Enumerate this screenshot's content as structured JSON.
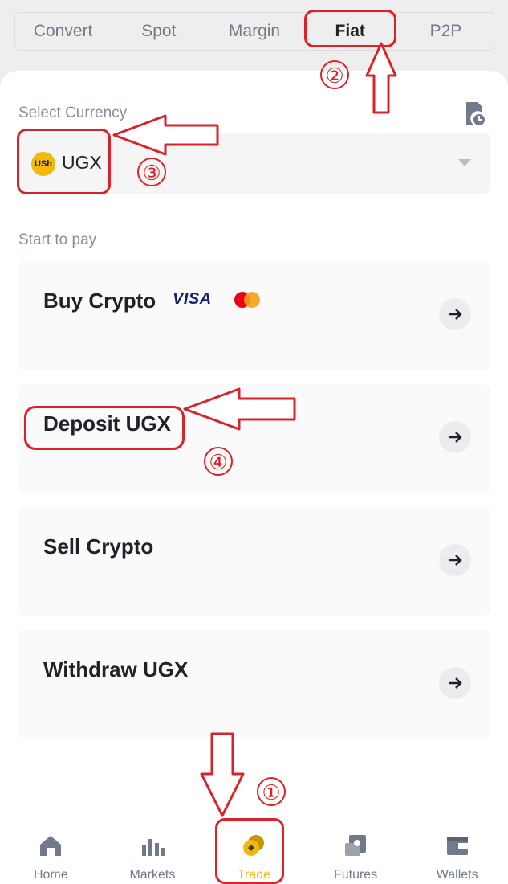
{
  "tabs": [
    "Convert",
    "Spot",
    "Margin",
    "Fiat",
    "P2P"
  ],
  "active_tab": "Fiat",
  "select_currency_label": "Select Currency",
  "currency": {
    "badge": "USh",
    "code": "UGX"
  },
  "start_to_pay_label": "Start to pay",
  "options": {
    "buy": {
      "title": "Buy Crypto",
      "visa": "VISA",
      "mastercard": "MasterCard"
    },
    "deposit": {
      "title": "Deposit UGX"
    },
    "sell": {
      "title": "Sell Crypto"
    },
    "withdraw": {
      "title": "Withdraw UGX"
    }
  },
  "annotations": [
    "①",
    "②",
    "③",
    "④"
  ],
  "nav": [
    {
      "label": "Home",
      "icon": "home-icon"
    },
    {
      "label": "Markets",
      "icon": "markets-icon"
    },
    {
      "label": "Trade",
      "icon": "trade-icon"
    },
    {
      "label": "Futures",
      "icon": "futures-icon"
    },
    {
      "label": "Wallets",
      "icon": "wallet-icon"
    }
  ],
  "colors": {
    "accent": "#f0b90b",
    "annotation": "#d8232a",
    "text": "#1e2329",
    "muted": "#707a8a"
  }
}
